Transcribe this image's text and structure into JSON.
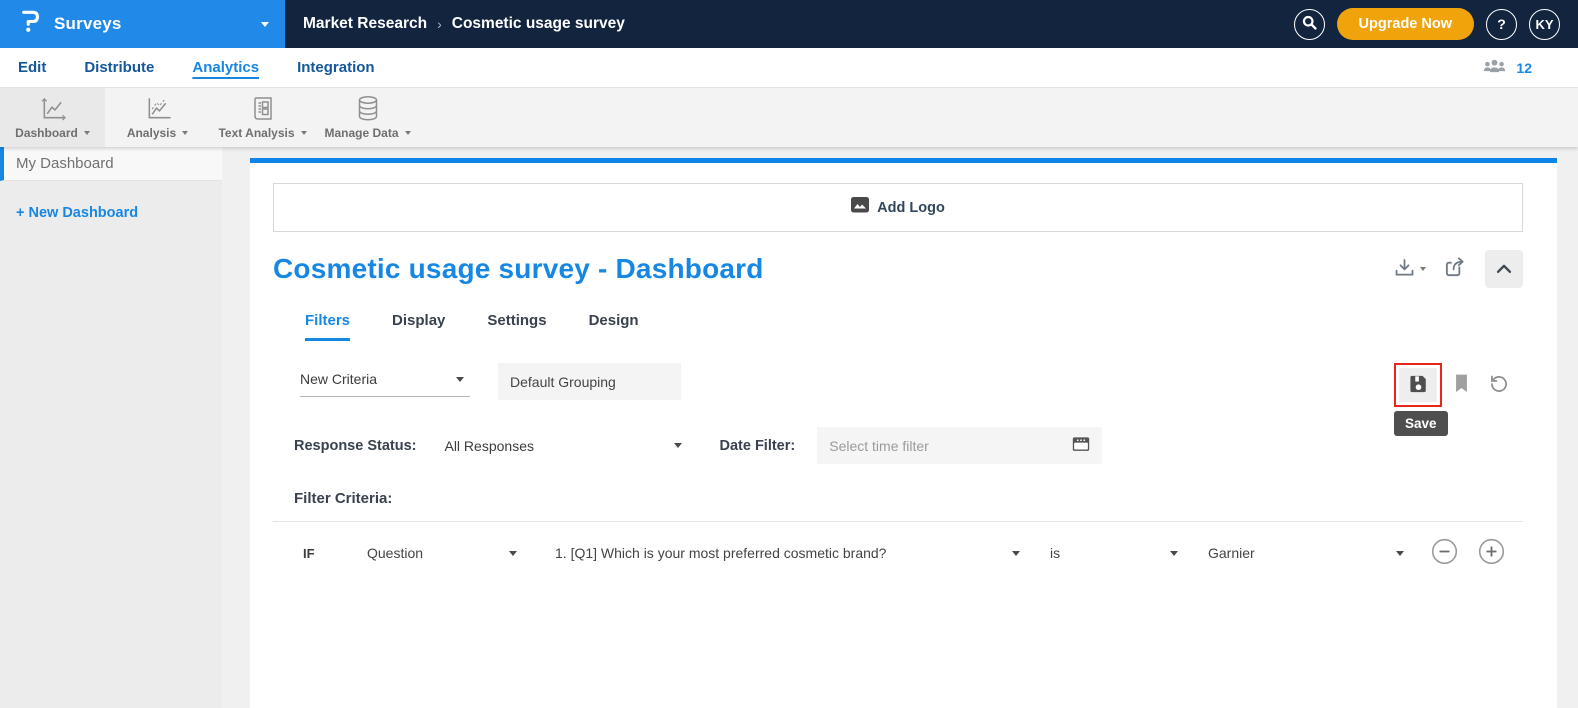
{
  "header": {
    "app_name": "Surveys",
    "breadcrumb": [
      "Market Research",
      "Cosmetic usage survey"
    ],
    "breadcrumb_separator": "›",
    "upgrade_label": "Upgrade Now",
    "help_label": "?",
    "avatar_initials": "KY"
  },
  "nav": {
    "items": [
      "Edit",
      "Distribute",
      "Analytics",
      "Integration"
    ],
    "active": "Analytics",
    "respondents_count": "12"
  },
  "toolbar": {
    "items": [
      {
        "label": "Dashboard",
        "icon": "line-chart-icon"
      },
      {
        "label": "Analysis",
        "icon": "trend-chart-icon"
      },
      {
        "label": "Text Analysis",
        "icon": "document-icon"
      },
      {
        "label": "Manage Data",
        "icon": "database-icon"
      }
    ]
  },
  "sidebar": {
    "active_item": "My Dashboard",
    "new_dashboard_label": "+ New Dashboard"
  },
  "main": {
    "add_logo_label": "Add Logo",
    "title": "Cosmetic usage survey - Dashboard",
    "tabs": [
      "Filters",
      "Display",
      "Settings",
      "Design"
    ],
    "active_tab": "Filters",
    "filters": {
      "criteria_value": "New Criteria",
      "grouping_value": "Default Grouping",
      "save_tooltip": "Save",
      "response_status_label": "Response Status:",
      "response_status_value": "All Responses",
      "date_filter_label": "Date Filter:",
      "date_filter_placeholder": "Select time filter",
      "criteria_section_label": "Filter Criteria:",
      "row": {
        "prefix": "IF",
        "field": "Question",
        "question": "1. [Q1] Which is your most preferred cosmetic brand?",
        "operator": "is",
        "value": "Garnier"
      }
    }
  },
  "colors": {
    "brand_blue": "#2189e8",
    "navy": "#13243f",
    "accent_blue": "#1787e4",
    "upgrade_orange": "#f0a30b",
    "highlight_red": "#e8271c"
  }
}
